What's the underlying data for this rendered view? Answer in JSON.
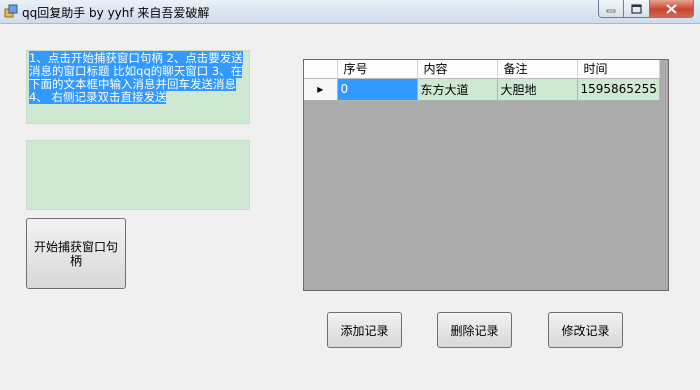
{
  "window": {
    "title": "qq回复助手 by yyhf 来自吾爱破解"
  },
  "instructions": {
    "text": "1、点击开始捕获窗口句柄 2、点击要发送消息的窗口标题 比如qq的聊天窗口 3、在下面的文本框中输入消息并回车发送消息 4、 右侧记录双击直接发送"
  },
  "message_input": {
    "value": ""
  },
  "buttons": {
    "capture": "开始捕获窗口句柄",
    "add": "添加记录",
    "delete": "删除记录",
    "edit": "修改记录"
  },
  "grid": {
    "columns": [
      "序号",
      "内容",
      "备注",
      "时间"
    ],
    "rows": [
      {
        "indicator": "▸",
        "cells": [
          "0",
          "东方大道",
          "大胆地",
          "1595865255"
        ]
      }
    ]
  },
  "colors": {
    "textbox_bg": "#cfe8d2",
    "selection": "#3399ff",
    "grid_bg": "#ababab"
  }
}
